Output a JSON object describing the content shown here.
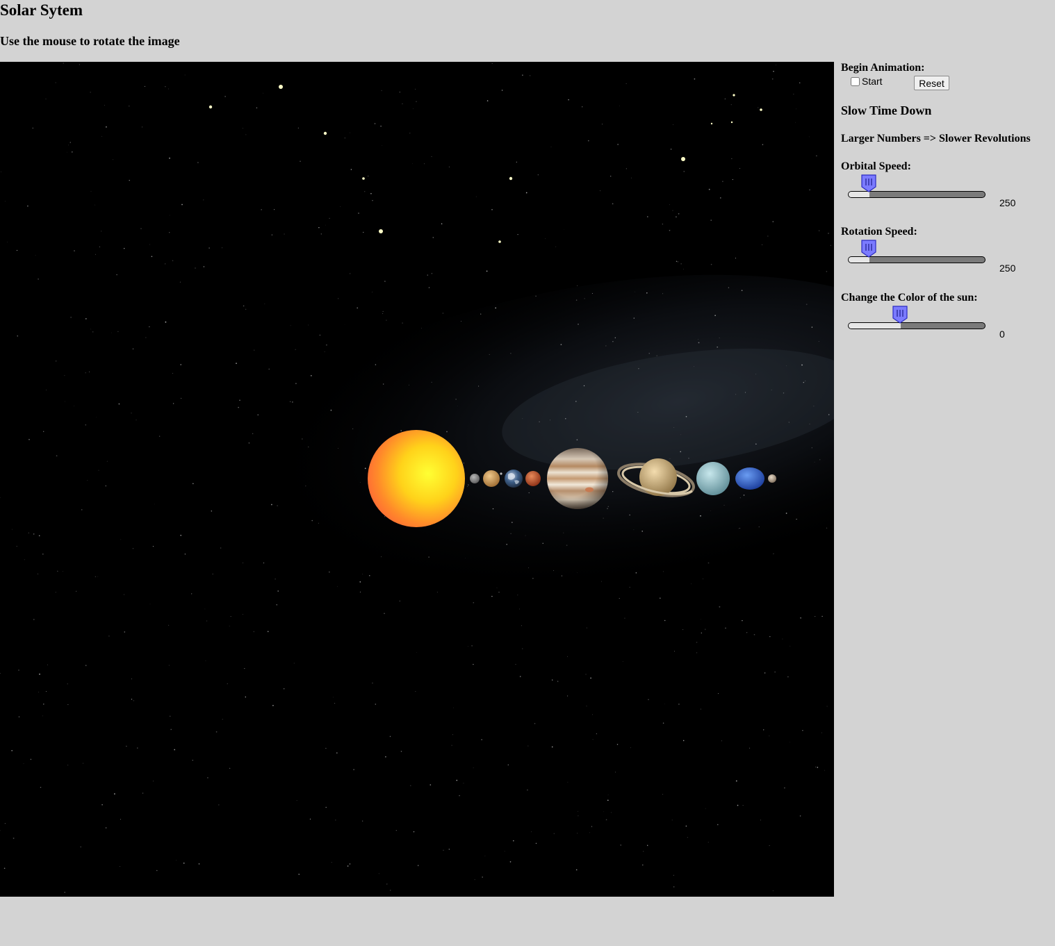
{
  "header": {
    "title": "Solar Sytem",
    "subtitle": "Use the mouse to rotate the image"
  },
  "scene": {
    "background": "#000000",
    "sun_color": "#ffd21a",
    "bodies": [
      "sun",
      "mercury",
      "venus",
      "earth",
      "moon",
      "mars",
      "jupiter",
      "saturn",
      "uranus",
      "neptune",
      "pluto"
    ]
  },
  "controls": {
    "begin_label": "Begin Animation:",
    "start_label": "Start",
    "start_checked": false,
    "reset_label": "Reset",
    "slow_heading": "Slow Time Down",
    "larger_note": "Larger Numbers => Slower Revolutions",
    "orbital": {
      "label": "Orbital Speed:",
      "value": "250",
      "fraction": 0.13
    },
    "rotation": {
      "label": "Rotation Speed:",
      "value": "250",
      "fraction": 0.13
    },
    "sun_color": {
      "label": "Change the Color of the sun:",
      "value": "0",
      "fraction": 0.37
    },
    "accent_color": "#7b7bff"
  }
}
